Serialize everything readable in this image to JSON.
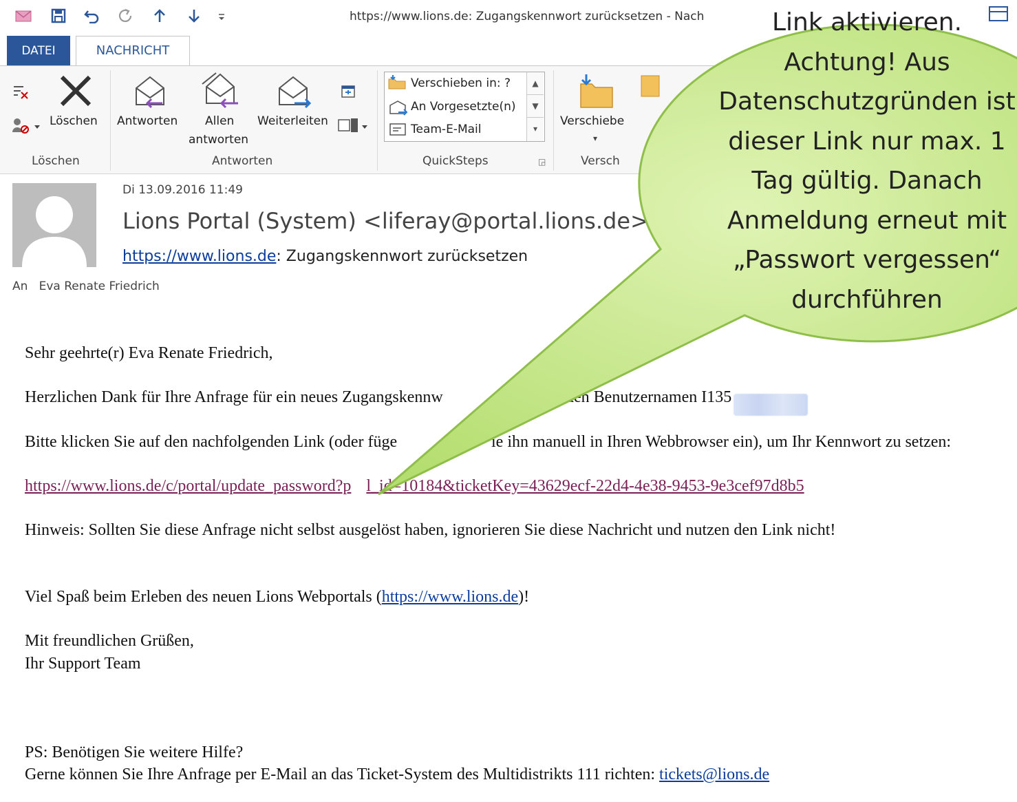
{
  "window": {
    "title": "https://www.lions.de: Zugangskennwort zurücksetzen - Nach"
  },
  "tabs": {
    "file": "DATEI",
    "message": "NACHRICHT"
  },
  "ribbon": {
    "delete_group": {
      "delete_label": "Löschen",
      "group_label": "Löschen"
    },
    "respond_group": {
      "reply": "Antworten",
      "reply_all_line1": "Allen",
      "reply_all_line2": "antworten",
      "forward": "Weiterleiten",
      "group_label": "Antworten"
    },
    "quicksteps": {
      "items": [
        "Verschieben in: ?",
        "An Vorgesetzte(n)",
        "Team-E-Mail"
      ],
      "group_label": "QuickSteps"
    },
    "move_group": {
      "move_label": "Verschiebe",
      "group_label": "Versch"
    }
  },
  "message": {
    "date": "Di 13.09.2016 11:49",
    "sender": "Lions Portal (System) <liferay@portal.lions.de>",
    "subject_link": "https://www.lions.de",
    "subject_rest": ": Zugangskennwort zurücksetzen",
    "to_label": "An",
    "to_name": "Eva Renate Friedrich"
  },
  "body": {
    "greeting": "Sehr geehrte(r) Eva Renate Friedrich,",
    "thanks_a": "Herzlichen Dank für Ihre Anfrage für ein neues Zugangskennw",
    "thanks_b": "den Benutzernamen I135",
    "click_a": "Bitte klicken Sie auf den nachfolgenden Link (oder füge",
    "click_b": "ie ihn manuell in Ihren Webbrowser ein), um Ihr Kennwort zu setzen:",
    "reset_link_a": "https://www.lions.de/c/portal/update_password?p",
    "reset_link_b": "l_id=10184&ticketKey=43629ecf-22d4-4e38-9453-9e3cef97d8b5",
    "note": "Hinweis: Sollten Sie diese Anfrage nicht selbst ausgelöst haben, ignorieren Sie diese Nachricht und nutzen den Link nicht!",
    "fun_a": "Viel Spaß beim Erleben des neuen Lions Webportals (",
    "fun_link": "https://www.lions.de",
    "fun_b": ")!",
    "regards": "Mit freundlichen Grüßen,",
    "team": "Ihr Support Team",
    "ps": "PS: Benötigen Sie weitere Hilfe?",
    "ticket_a": "Gerne können Sie Ihre Anfrage per E-Mail an das Ticket-System des Multidistrikts 111 richten: ",
    "ticket_link": "tickets@lions.de"
  },
  "callout": {
    "lines": [
      "Link aktivieren.",
      "Achtung! Aus",
      "Datenschutzgründen ist",
      "dieser Link nur max. 1",
      "Tag gültig. Danach",
      "Anmeldung erneut mit",
      "„Passwort vergessen“",
      "durchführen"
    ]
  },
  "colors": {
    "accent": "#2b579a",
    "callout_fill": "#c6ea8e",
    "visited_link": "#7a1f55",
    "link": "#0b3c9e"
  }
}
